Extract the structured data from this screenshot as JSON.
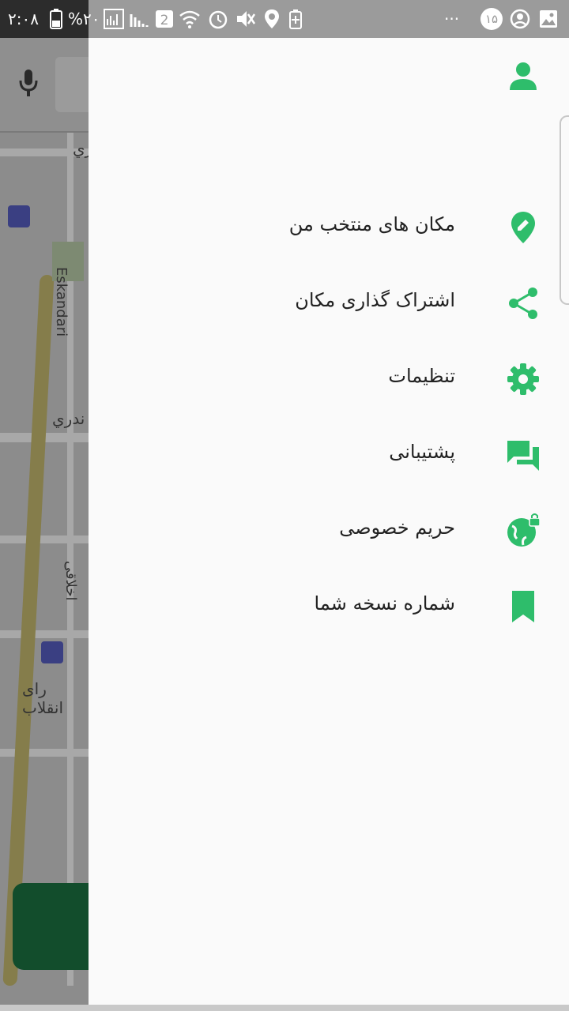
{
  "status_bar": {
    "time": "۲:۰۸",
    "battery": "%۲۰",
    "notification_count": "۱۵",
    "dots": "···"
  },
  "map": {
    "labels": [
      "ري",
      "Eskandari",
      "ندري",
      "اخلاقی",
      "رای انقلاب"
    ]
  },
  "drawer": {
    "items": [
      {
        "label": "مکان های منتخب من",
        "icon": "edit-location-icon"
      },
      {
        "label": "اشتراک گذاری مکان",
        "icon": "share-icon"
      },
      {
        "label": "تنظیمات",
        "icon": "gear-icon"
      },
      {
        "label": "پشتیبانی",
        "icon": "chat-icon"
      },
      {
        "label": "حریم خصوصی",
        "icon": "globe-lock-icon"
      },
      {
        "label": "شماره نسخه شما",
        "icon": "bookmark-icon"
      }
    ]
  },
  "colors": {
    "accent": "#2ebd6b",
    "drawer_bg": "#fafafa",
    "text": "#222222"
  }
}
